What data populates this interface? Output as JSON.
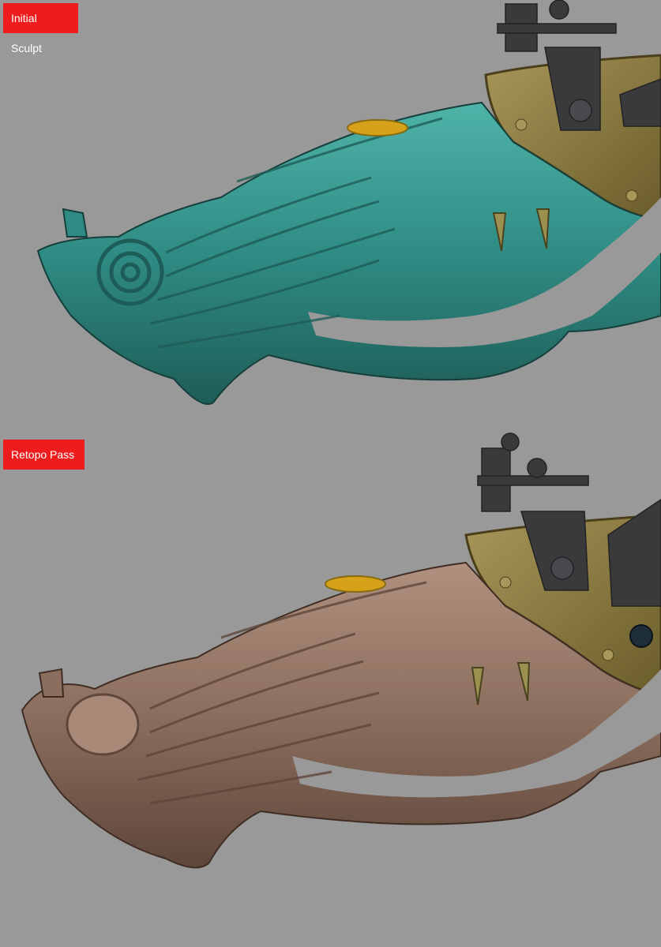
{
  "panels": [
    {
      "label": "Initial Sculpt",
      "label_color": "#ee1c1c",
      "material_color": "#2f8c84",
      "material_dark": "#1e5c57",
      "material_light": "#4fb3a8"
    },
    {
      "label": "Retopo Pass",
      "label_color": "#ee1c1c",
      "material_color": "#8c6e5e",
      "material_dark": "#5e463a",
      "material_light": "#b0917f"
    }
  ],
  "colors": {
    "background": "#999999",
    "brass": "#8a7a3e",
    "brass_dark": "#5a4e22",
    "gold": "#d6a21a",
    "metal": "#3a3a3d"
  }
}
